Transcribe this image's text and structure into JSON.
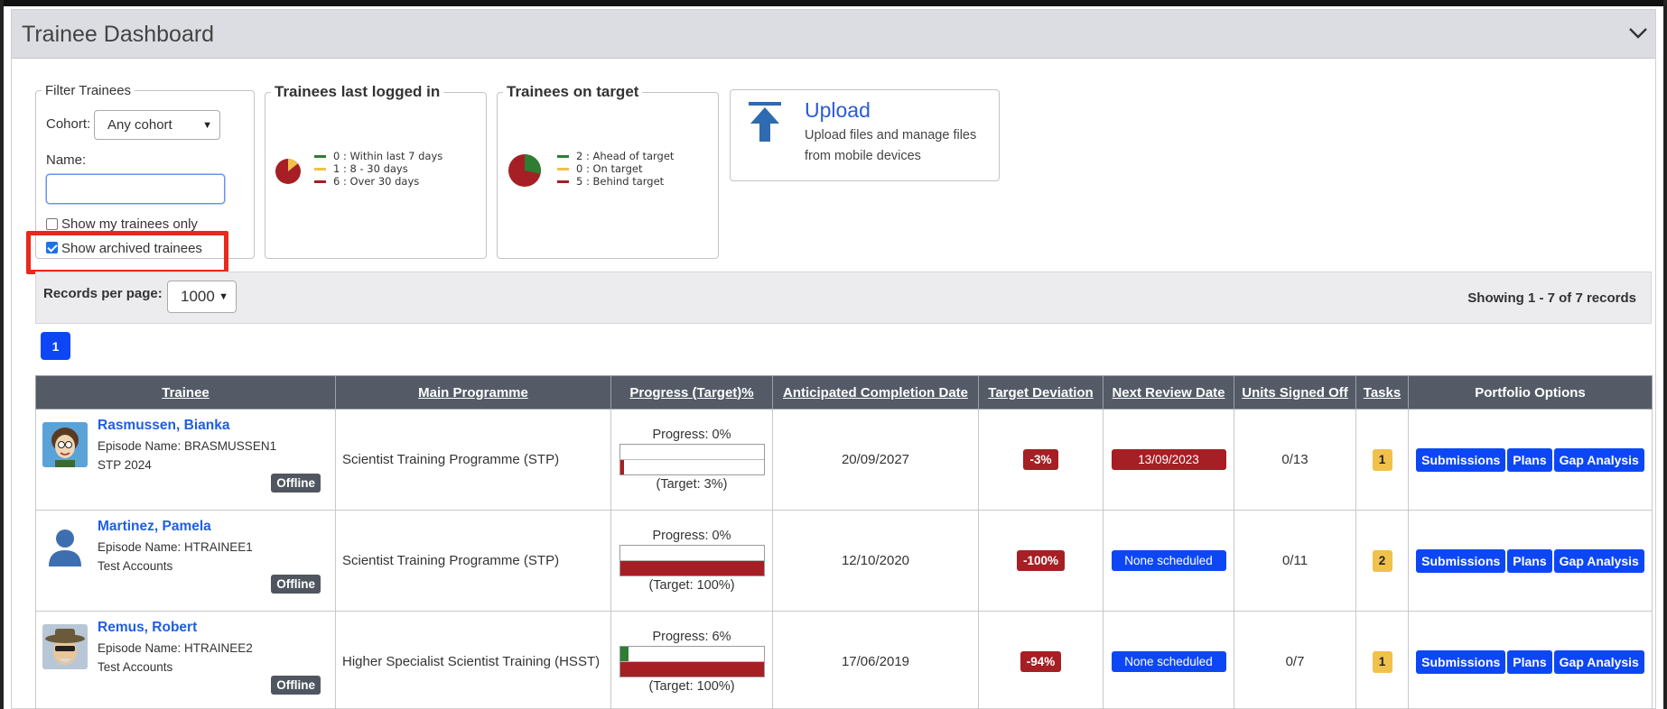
{
  "panel": {
    "title": "Trainee Dashboard"
  },
  "filter": {
    "legend": "Filter Trainees",
    "cohort_label": "Cohort:",
    "cohort_value": "Any cohort",
    "name_label": "Name:",
    "name_value": "",
    "show_my_label": "Show my trainees only",
    "show_my_checked": false,
    "show_archived_label": "Show archived trainees",
    "show_archived_checked": true
  },
  "logged_in": {
    "legend": "Trainees last logged in",
    "items": [
      {
        "label": "0 : Within last 7 days",
        "value": 0,
        "color": "#2e7d32"
      },
      {
        "label": "1 : 8 - 30 days",
        "value": 1,
        "color": "#f0c14b"
      },
      {
        "label": "6 : Over 30 days",
        "value": 6,
        "color": "#a51f24"
      }
    ]
  },
  "on_target": {
    "legend": "Trainees on target",
    "items": [
      {
        "label": "2 : Ahead of target",
        "value": 2,
        "color": "#2e7d32"
      },
      {
        "label": "0 : On target",
        "value": 0,
        "color": "#f0c14b"
      },
      {
        "label": "5 : Behind target",
        "value": 5,
        "color": "#a51f24"
      }
    ]
  },
  "upload": {
    "title": "Upload",
    "description": "Upload files and manage files from mobile devices",
    "icon": "upload-arrow-icon"
  },
  "records": {
    "per_page_label": "Records per page:",
    "per_page_value": "1000",
    "showing": "Showing 1 - 7 of 7 records"
  },
  "pagination": {
    "current": "1"
  },
  "table": {
    "headers": [
      "Trainee",
      "Main Programme",
      "Progress (Target)%",
      "Anticipated Completion Date",
      "Target Deviation",
      "Next Review Date",
      "Units Signed Off",
      "Tasks",
      "Portfolio Options"
    ],
    "rows": [
      {
        "name": "Rasmussen, Bianka",
        "episode": "Episode Name: BRASMUSSEN1",
        "cohort": "STP 2024",
        "status": "Offline",
        "avatar": "cartoon-avatar-icon",
        "programme": "Scientist Training Programme (STP)",
        "progress_label": "Progress: 0%",
        "progress": 0,
        "target_label": "(Target: 3%)",
        "target": 3,
        "completion": "20/09/2027",
        "deviation": "-3%",
        "review": "13/09/2023",
        "review_color": "#a51f24",
        "units": "0/13",
        "tasks": "1",
        "options": [
          "Submissions",
          "Plans",
          "Gap Analysis"
        ]
      },
      {
        "name": "Martinez, Pamela",
        "episode": "Episode Name: HTRAINEE1",
        "cohort": "Test Accounts",
        "status": "Offline",
        "avatar": "person-silhouette-icon",
        "programme": "Scientist Training Programme (STP)",
        "progress_label": "Progress: 0%",
        "progress": 0,
        "target_label": "(Target: 100%)",
        "target": 100,
        "completion": "12/10/2020",
        "deviation": "-100%",
        "review": "None scheduled",
        "review_color": "#0d47f5",
        "units": "0/11",
        "tasks": "2",
        "options": [
          "Submissions",
          "Plans",
          "Gap Analysis"
        ]
      },
      {
        "name": "Remus, Robert",
        "episode": "Episode Name: HTRAINEE2",
        "cohort": "Test Accounts",
        "status": "Offline",
        "avatar": "cartoon-hat-avatar-icon",
        "programme": "Higher Specialist Scientist Training (HSST)",
        "progress_label": "Progress: 6%",
        "progress": 6,
        "target_label": "(Target: 100%)",
        "target": 100,
        "completion": "17/06/2019",
        "deviation": "-94%",
        "review": "None scheduled",
        "review_color": "#0d47f5",
        "units": "0/7",
        "tasks": "1",
        "options": [
          "Submissions",
          "Plans",
          "Gap Analysis"
        ]
      }
    ]
  }
}
